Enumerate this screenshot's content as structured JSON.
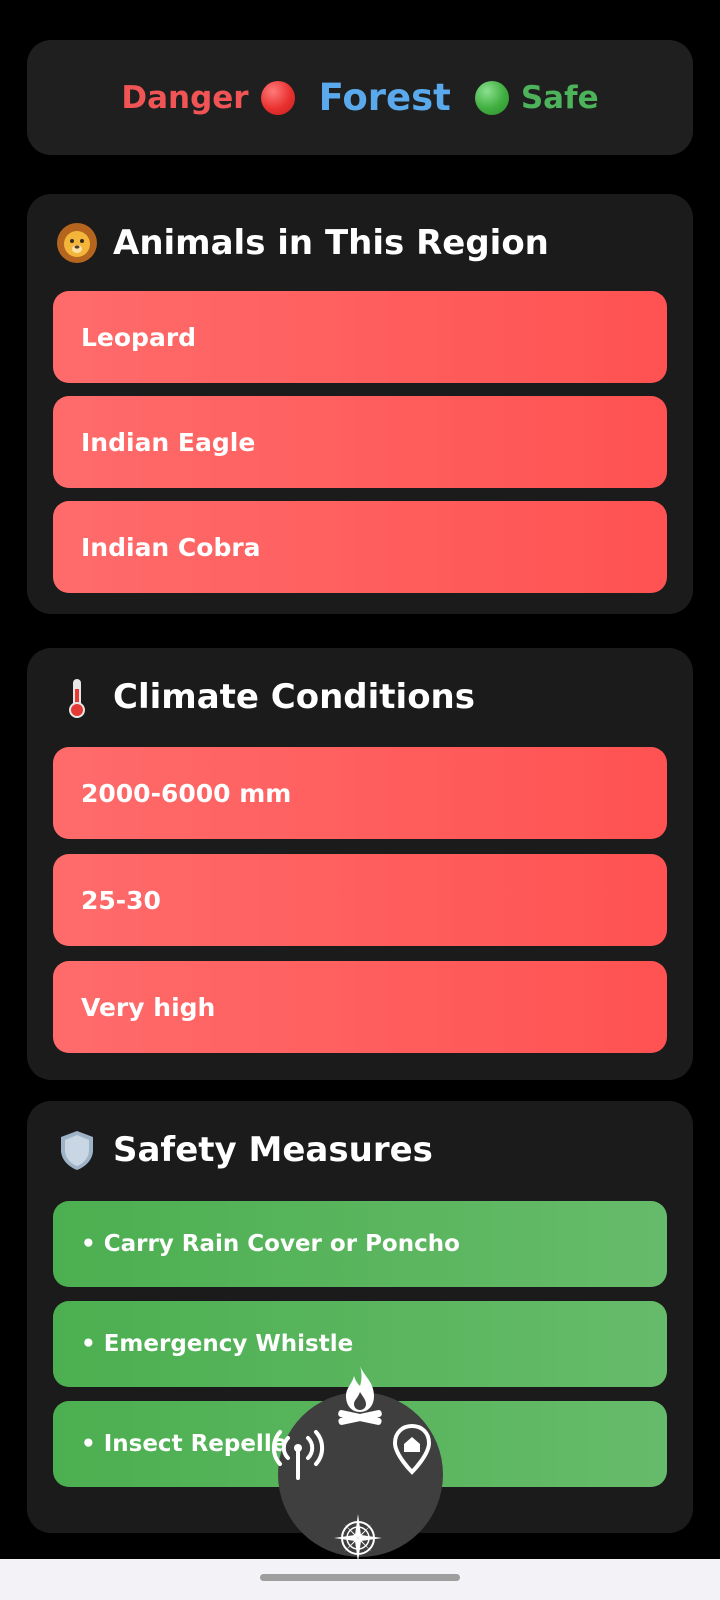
{
  "header": {
    "danger_label": "Danger",
    "forest_label": "Forest",
    "safe_label": "Safe",
    "colors": {
      "danger": "#f05454",
      "forest": "#5aa9ec",
      "safe": "#4db35a"
    }
  },
  "animals": {
    "title": "Animals in This Region",
    "icon": "lion-face-icon",
    "items": [
      "Leopard",
      "Indian Eagle",
      "Indian Cobra"
    ]
  },
  "climate": {
    "title": "Climate Conditions",
    "icon": "thermometer-icon",
    "items": [
      "2000-6000 mm",
      "25-30",
      "Very high"
    ]
  },
  "safety": {
    "title": "Safety Measures",
    "icon": "shield-icon",
    "items": [
      "• Carry Rain Cover or Poncho",
      "• Emergency Whistle",
      "• Insect Repeller"
    ]
  },
  "fab_menu": {
    "icons": [
      "campfire-icon",
      "signal-tower-icon",
      "home-pin-icon",
      "compass-icon"
    ]
  },
  "colors": {
    "danger_item": "#ff5c5c",
    "safe_item": "#5cb85c",
    "card_bg": "#1b1b1b"
  }
}
